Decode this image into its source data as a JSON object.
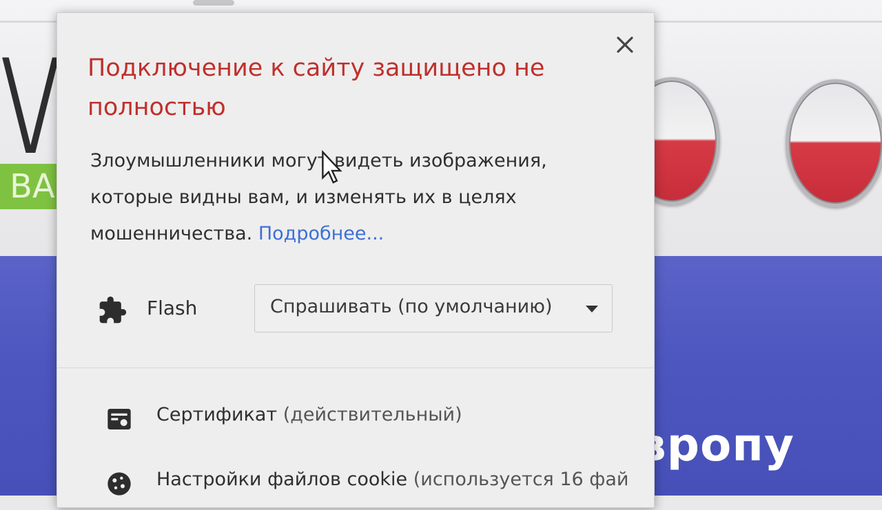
{
  "popup": {
    "title": "Подключение к сайту защищено не полностью",
    "description": "Злоумышленники могут видеть изображения, которые видны вам, и изменять их в целях мошенничества.",
    "learn_more_link": "Подробнее...",
    "close_icon": "close-icon",
    "title_color": "#c0302c",
    "link_color": "#3c6fd6"
  },
  "permissions": [
    {
      "icon": "puzzle-icon",
      "label": "Flash",
      "value": "Спрашивать (по умолчанию)"
    }
  ],
  "items": {
    "certificate": {
      "icon": "certificate-icon",
      "label": "Сертификат",
      "status": "(действительный)"
    },
    "cookies": {
      "icon": "cookie-icon",
      "label": "Настройки файлов cookie",
      "status": "(используется 16 фай"
    }
  },
  "background_page": {
    "logo_letter": "W",
    "logo_badge": "BA",
    "headline_fragment": "вропу",
    "blue_color": "#4d56bf",
    "badge_color": "#7fc241"
  }
}
